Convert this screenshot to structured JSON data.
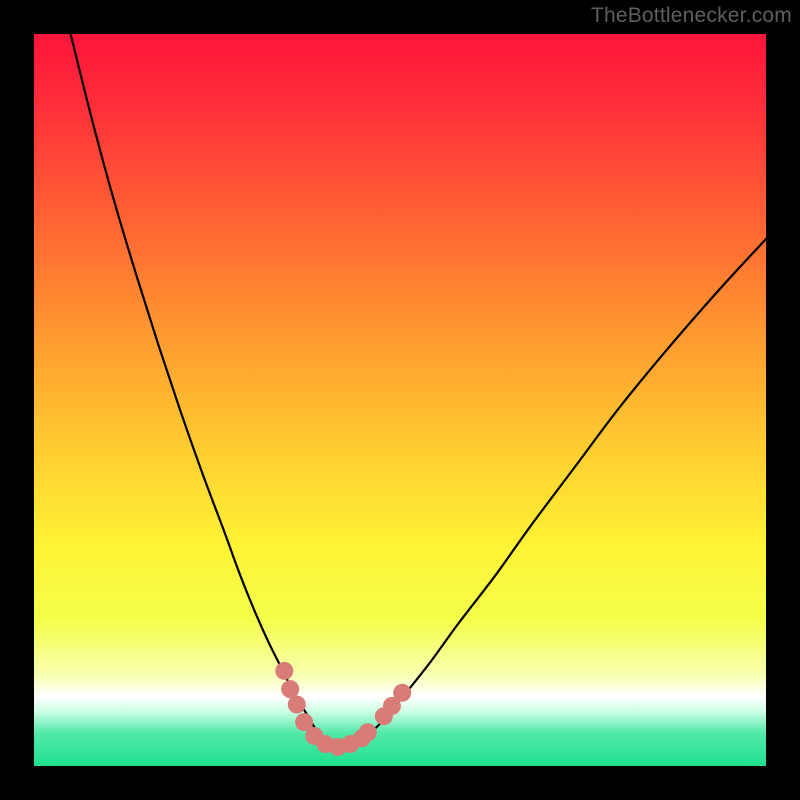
{
  "watermark": "TheBottlenecker.com",
  "colors": {
    "bg": "#000000",
    "curve": "#000000",
    "dots": "#d97b77",
    "gradient_stops": [
      {
        "offset": 0.0,
        "color": "#ff153b"
      },
      {
        "offset": 0.1,
        "color": "#ff2f39"
      },
      {
        "offset": 0.25,
        "color": "#ff6133"
      },
      {
        "offset": 0.4,
        "color": "#ff9630"
      },
      {
        "offset": 0.55,
        "color": "#ffc830"
      },
      {
        "offset": 0.7,
        "color": "#fff335"
      },
      {
        "offset": 0.8,
        "color": "#f3ff4a"
      },
      {
        "offset": 0.875,
        "color": "#f8ffb0"
      },
      {
        "offset": 0.905,
        "color": "#ffffff"
      },
      {
        "offset": 0.925,
        "color": "#cfffe6"
      },
      {
        "offset": 0.955,
        "color": "#52e9aa"
      },
      {
        "offset": 1.0,
        "color": "#1ee08f"
      }
    ]
  },
  "chart_data": {
    "type": "line",
    "title": "",
    "xlabel": "",
    "ylabel": "",
    "xlim": [
      0,
      100
    ],
    "ylim": [
      0,
      100
    ],
    "series": [
      {
        "name": "bottleneck-curve",
        "x": [
          5,
          8,
          11,
          14,
          17,
          20,
          23,
          26,
          28,
          30,
          32,
          34,
          35.5,
          37,
          38.5,
          40,
          42,
          44,
          47,
          50,
          54,
          58,
          63,
          68,
          74,
          80,
          87,
          94,
          100
        ],
        "y": [
          100,
          88,
          77,
          67,
          57.5,
          48.5,
          40,
          32,
          26.5,
          21.5,
          17,
          13,
          10,
          7.5,
          5,
          3.3,
          2.5,
          3.2,
          5.5,
          9,
          14,
          19.5,
          26,
          33,
          41,
          49,
          57.5,
          65.5,
          72
        ]
      }
    ],
    "markers": {
      "name": "highlight-dots",
      "points": [
        {
          "x": 34.2,
          "y": 13.0
        },
        {
          "x": 35.0,
          "y": 10.5
        },
        {
          "x": 35.9,
          "y": 8.4
        },
        {
          "x": 36.9,
          "y": 6.0
        },
        {
          "x": 38.3,
          "y": 4.1
        },
        {
          "x": 39.8,
          "y": 3.0
        },
        {
          "x": 41.5,
          "y": 2.6
        },
        {
          "x": 43.2,
          "y": 3.0
        },
        {
          "x": 44.8,
          "y": 3.8
        },
        {
          "x": 45.6,
          "y": 4.6
        },
        {
          "x": 47.8,
          "y": 6.8
        },
        {
          "x": 48.9,
          "y": 8.2
        },
        {
          "x": 50.3,
          "y": 10.0
        }
      ]
    }
  }
}
